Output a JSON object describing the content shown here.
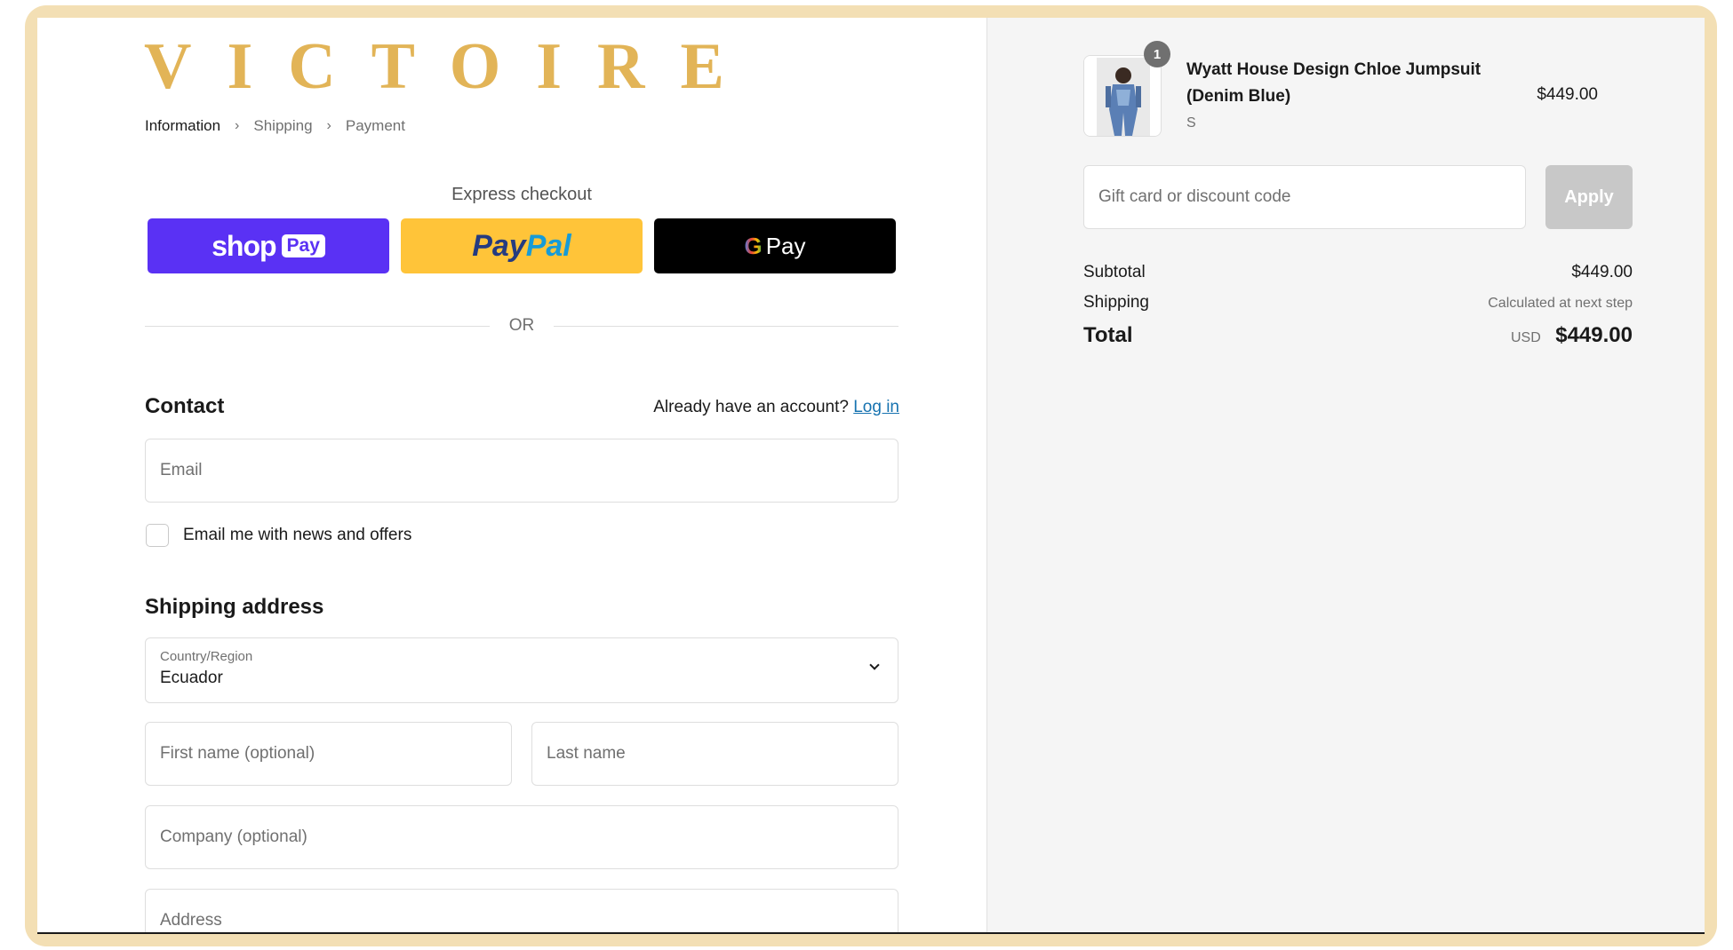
{
  "brand": {
    "logo_text": "VICTOIRE",
    "accent_color": "#e2b457"
  },
  "breadcrumb": {
    "items": [
      "Information",
      "Shipping",
      "Payment"
    ]
  },
  "express": {
    "title": "Express checkout",
    "shop_pay": {
      "word": "shop",
      "pill": "Pay"
    },
    "paypal": {
      "part1": "Pay",
      "part2": "Pal"
    },
    "gpay": {
      "g": "G",
      "label": "Pay"
    },
    "or_label": "OR"
  },
  "contact": {
    "title": "Contact",
    "account_prompt": "Already have an account?",
    "login_link": "Log in",
    "email_placeholder": "Email",
    "newsletter_label": "Email me with news and offers"
  },
  "shipping_address": {
    "title": "Shipping address",
    "country_label": "Country/Region",
    "country_value": "Ecuador",
    "first_name_placeholder": "First name (optional)",
    "last_name_placeholder": "Last name",
    "company_placeholder": "Company (optional)",
    "address_placeholder": "Address"
  },
  "order": {
    "product": {
      "quantity": "1",
      "name": "Wyatt House Design Chloe Jumpsuit (Denim Blue)",
      "variant": "S",
      "price": "$449.00"
    },
    "discount_placeholder": "Gift card or discount code",
    "apply_label": "Apply",
    "subtotal_label": "Subtotal",
    "subtotal_value": "$449.00",
    "shipping_label": "Shipping",
    "shipping_value": "Calculated at next step",
    "total_label": "Total",
    "total_currency": "USD",
    "total_value": "$449.00"
  }
}
